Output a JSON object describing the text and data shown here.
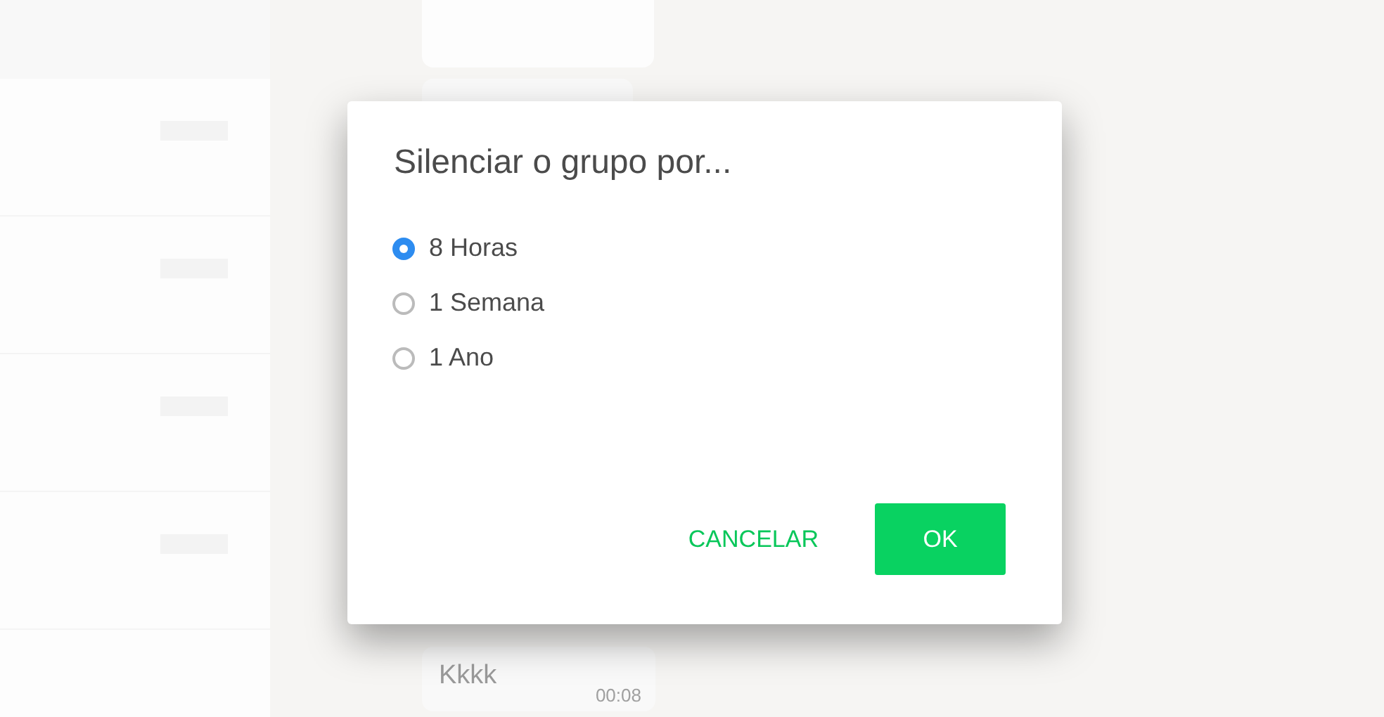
{
  "background_chat": {
    "messages": [
      {
        "text": "Kkkk",
        "time": "00:08"
      }
    ]
  },
  "dialog": {
    "title": "Silenciar o grupo por...",
    "options": [
      {
        "label": "8 Horas",
        "selected": true
      },
      {
        "label": "1 Semana",
        "selected": false
      },
      {
        "label": "1 Ano",
        "selected": false
      }
    ],
    "buttons": [
      {
        "label": "CANCELAR",
        "kind": "text"
      },
      {
        "label": "OK",
        "kind": "primary"
      }
    ]
  }
}
